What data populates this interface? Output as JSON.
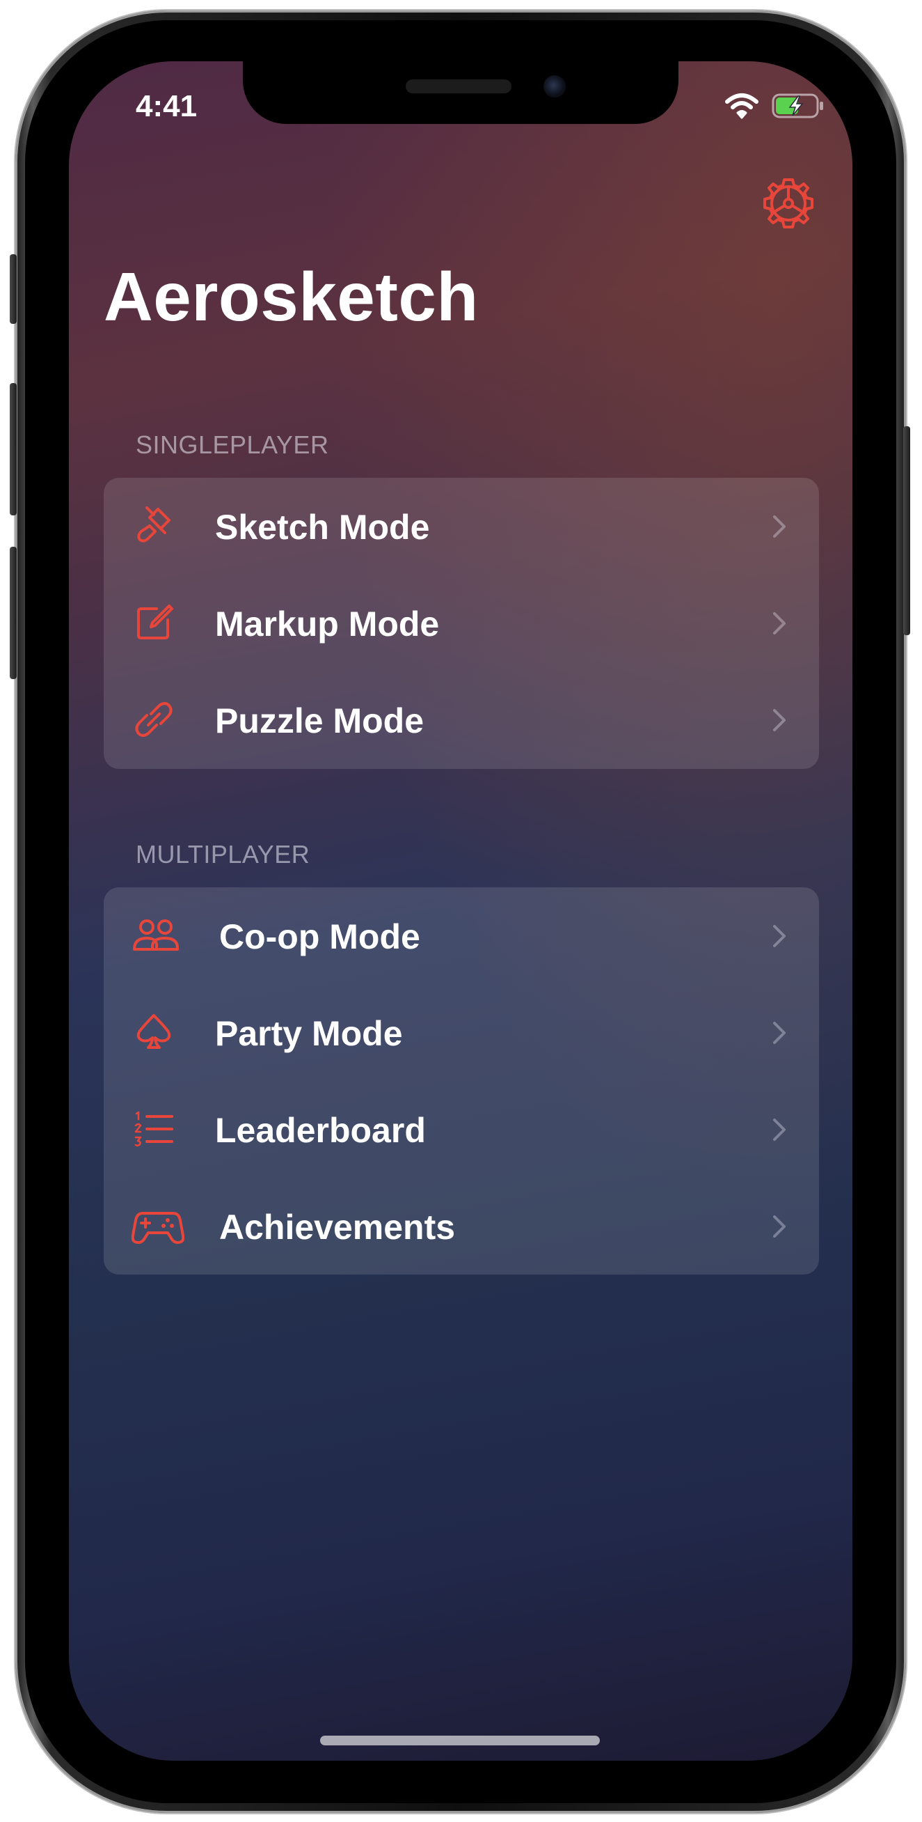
{
  "status_bar": {
    "time": "4:41",
    "icons": [
      "wifi-icon",
      "battery-charging-icon"
    ]
  },
  "header": {
    "title": "Aerosketch",
    "settings_icon": "gear-icon"
  },
  "colors": {
    "accent": "#e8463a",
    "label": "#ffffff",
    "section_header": "#9a98a8",
    "battery_fill": "#5ad14f"
  },
  "sections": {
    "singleplayer": {
      "header": "SINGLEPLAYER",
      "items": [
        {
          "label": "Sketch Mode",
          "icon": "paintbrush-icon"
        },
        {
          "label": "Markup Mode",
          "icon": "square-pencil-icon"
        },
        {
          "label": "Puzzle Mode",
          "icon": "link-icon"
        }
      ]
    },
    "multiplayer": {
      "header": "MULTIPLAYER",
      "items": [
        {
          "label": "Co-op Mode",
          "icon": "people-icon"
        },
        {
          "label": "Party Mode",
          "icon": "spade-icon"
        },
        {
          "label": "Leaderboard",
          "icon": "numbered-list-icon"
        },
        {
          "label": "Achievements",
          "icon": "game-controller-icon"
        }
      ]
    }
  }
}
